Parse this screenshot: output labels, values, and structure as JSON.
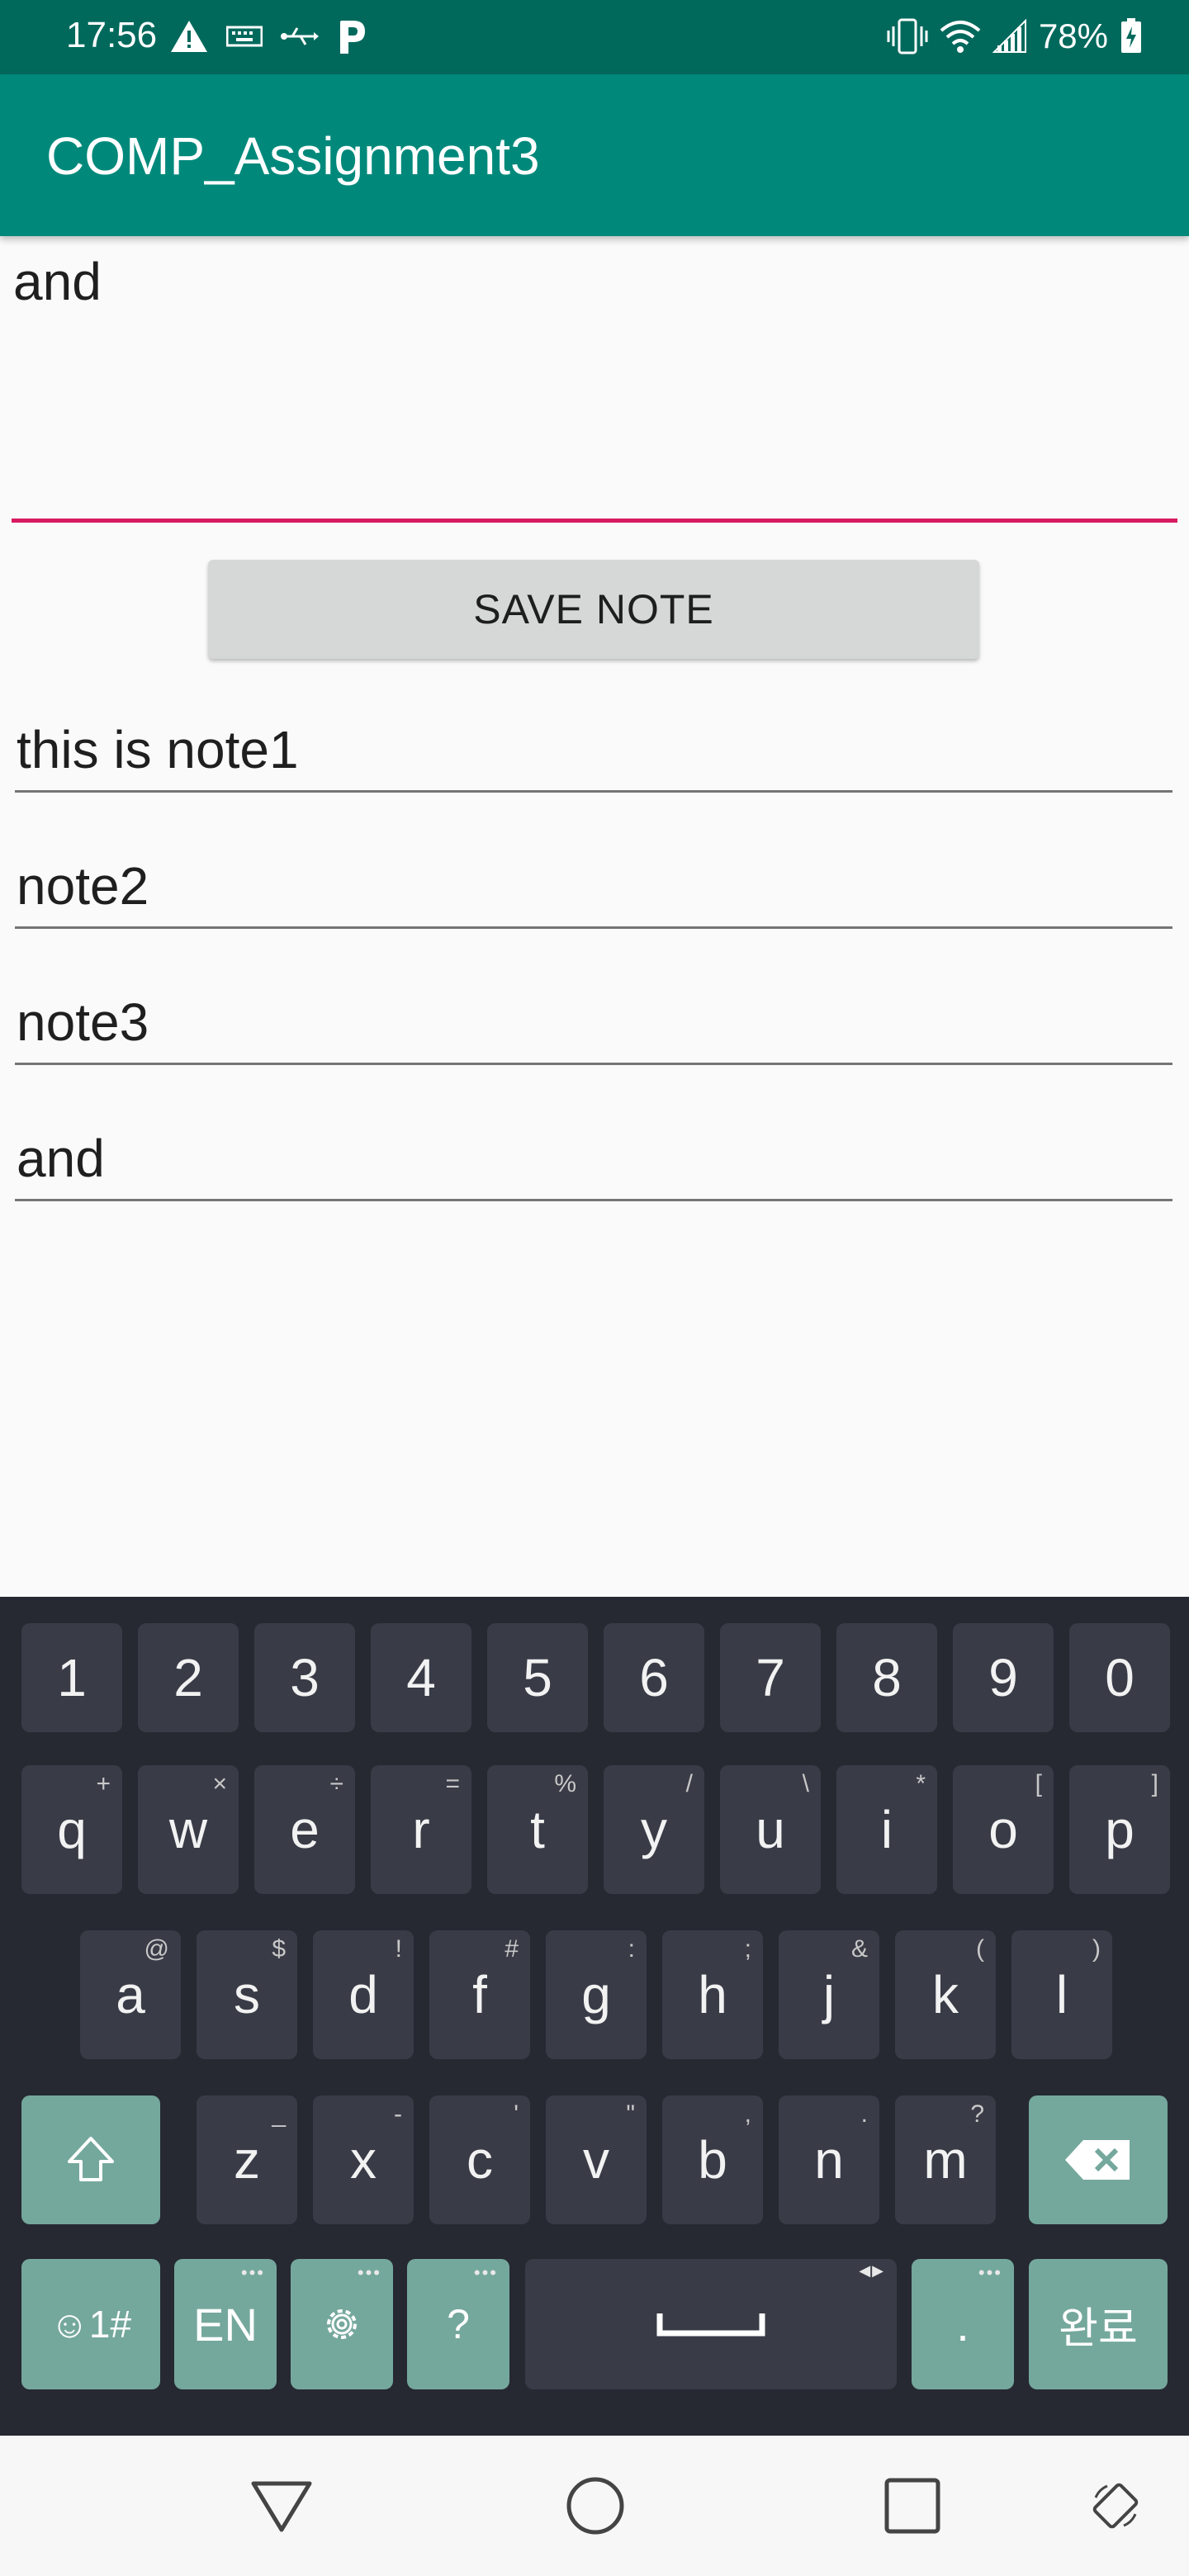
{
  "status_bar": {
    "time": "17:56",
    "battery_percent": "78%"
  },
  "app_bar": {
    "title": "COMP_Assignment3"
  },
  "editor": {
    "text": "and"
  },
  "save_button": {
    "label": "SAVE NOTE"
  },
  "notes": [
    {
      "text": "this is note1"
    },
    {
      "text": "note2"
    },
    {
      "text": "note3"
    },
    {
      "text": "and"
    }
  ],
  "keyboard": {
    "number_row": [
      "1",
      "2",
      "3",
      "4",
      "5",
      "6",
      "7",
      "8",
      "9",
      "0"
    ],
    "row1": [
      {
        "key": "q",
        "hint": "+"
      },
      {
        "key": "w",
        "hint": "×"
      },
      {
        "key": "e",
        "hint": "÷"
      },
      {
        "key": "r",
        "hint": "="
      },
      {
        "key": "t",
        "hint": "%"
      },
      {
        "key": "y",
        "hint": "/"
      },
      {
        "key": "u",
        "hint": "\\"
      },
      {
        "key": "i",
        "hint": "*"
      },
      {
        "key": "o",
        "hint": "["
      },
      {
        "key": "p",
        "hint": "]"
      }
    ],
    "row2": [
      {
        "key": "a",
        "hint": "@"
      },
      {
        "key": "s",
        "hint": "$"
      },
      {
        "key": "d",
        "hint": "!"
      },
      {
        "key": "f",
        "hint": "#"
      },
      {
        "key": "g",
        "hint": ":"
      },
      {
        "key": "h",
        "hint": ";"
      },
      {
        "key": "j",
        "hint": "&"
      },
      {
        "key": "k",
        "hint": "("
      },
      {
        "key": "l",
        "hint": ")"
      }
    ],
    "row3": [
      {
        "key": "z",
        "hint": "_"
      },
      {
        "key": "x",
        "hint": "-"
      },
      {
        "key": "c",
        "hint": "'"
      },
      {
        "key": "v",
        "hint": "\""
      },
      {
        "key": "b",
        "hint": ","
      },
      {
        "key": "n",
        "hint": "."
      },
      {
        "key": "m",
        "hint": "?"
      }
    ],
    "symbols_label": "☺1#",
    "language_label": "EN",
    "question_label": "?",
    "period_label": ".",
    "done_label": "완료"
  },
  "colors": {
    "status_bar": "#00695c",
    "app_bar": "#00897b",
    "accent": "#d81b60",
    "keyboard_bg": "#262932",
    "key_bg": "#393c47",
    "special_key_bg": "#75a89d"
  }
}
